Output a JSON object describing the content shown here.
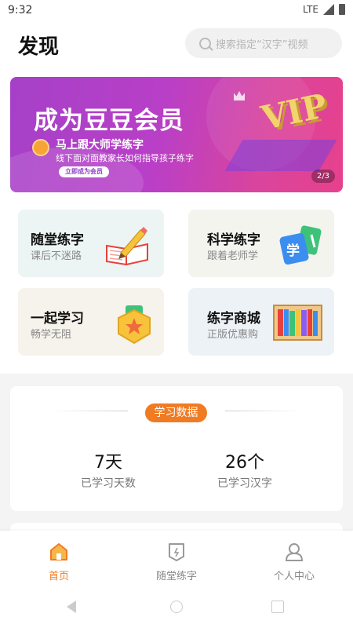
{
  "status_bar": {
    "time": "9:32",
    "network": "LTE"
  },
  "header": {
    "title": "发现",
    "search_placeholder": "搜索指定“汉字”视频"
  },
  "banner": {
    "headline": "成为豆豆会员",
    "sub_title": "马上跟大师学练字",
    "sub_desc": "线下面对面教家长如何指导孩子练字",
    "cta": "立即成为会员",
    "badge": "VIP",
    "pager": "2/3"
  },
  "features": [
    {
      "title": "随堂练字",
      "subtitle": "课后不迷路",
      "icon": "book-pencil-icon"
    },
    {
      "title": "科学练字",
      "subtitle": "跟着老师学",
      "icon": "study-cards-icon"
    },
    {
      "title": "一起学习",
      "subtitle": "畅学无阻",
      "icon": "star-badge-icon"
    },
    {
      "title": "练字商城",
      "subtitle": "正版优惠购",
      "icon": "bookshelf-icon"
    }
  ],
  "study_data": {
    "heading": "学习数据",
    "stats": [
      {
        "value": "7天",
        "label": "已学习天数"
      },
      {
        "value": "26个",
        "label": "已学习汉字"
      }
    ]
  },
  "bottom_nav": [
    {
      "label": "首页",
      "icon": "home-icon",
      "active": true
    },
    {
      "label": "随堂练字",
      "icon": "practice-icon",
      "active": false
    },
    {
      "label": "个人中心",
      "icon": "profile-icon",
      "active": false
    }
  ],
  "colors": {
    "accent": "#f07b23",
    "banner_start": "#a640c8",
    "banner_end": "#e7418d"
  }
}
